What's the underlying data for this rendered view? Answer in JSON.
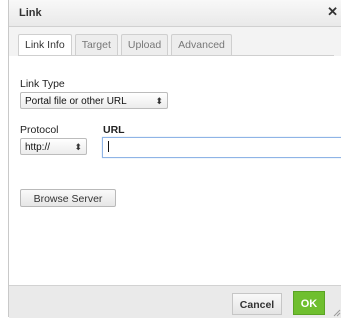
{
  "dialog": {
    "title": "Link",
    "close_glyph": "✕",
    "close_icon": "close-icon"
  },
  "tabs": [
    {
      "label": "Link Info",
      "active": true
    },
    {
      "label": "Target",
      "active": false
    },
    {
      "label": "Upload",
      "active": false
    },
    {
      "label": "Advanced",
      "active": false
    }
  ],
  "link_type": {
    "label": "Link Type",
    "selected": "Portal file or other URL"
  },
  "protocol": {
    "label": "Protocol",
    "selected": "http://"
  },
  "url": {
    "label": "URL",
    "value": ""
  },
  "browse_server_label": "Browse Server",
  "footer": {
    "cancel_label": "Cancel",
    "ok_label": "OK"
  },
  "colors": {
    "ok_button": "#6fbf2f",
    "focus_border": "#8fb4e6"
  },
  "select_arrow_glyph": "⬍"
}
